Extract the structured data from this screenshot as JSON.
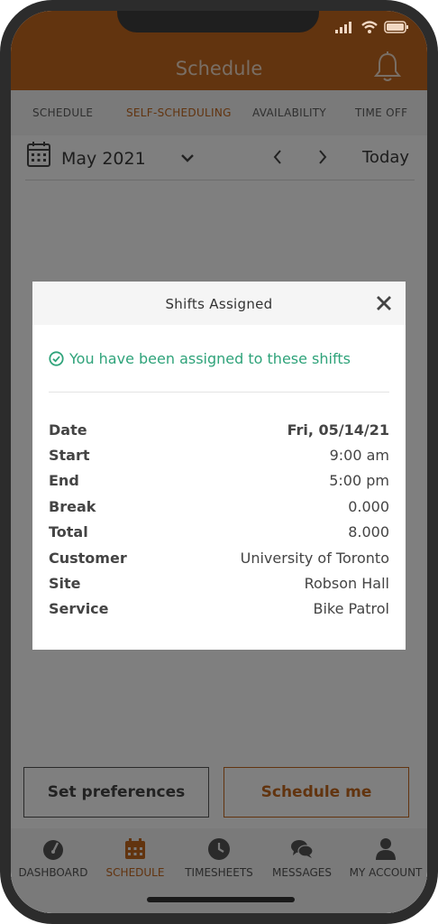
{
  "header": {
    "title": "Schedule"
  },
  "tabs": [
    {
      "label": "SCHEDULE"
    },
    {
      "label": "SELF-SCHEDULING"
    },
    {
      "label": "AVAILABILITY"
    },
    {
      "label": "TIME OFF"
    }
  ],
  "date_nav": {
    "month": "May 2021",
    "today_label": "Today"
  },
  "modal": {
    "title": "Shifts Assigned",
    "success_message": "You have been assigned to these shifts",
    "details": [
      {
        "label": "Date",
        "value": "Fri, 05/14/21"
      },
      {
        "label": "Start",
        "value": "9:00 am"
      },
      {
        "label": "End",
        "value": "5:00 pm"
      },
      {
        "label": "Break",
        "value": "0.000"
      },
      {
        "label": "Total",
        "value": "8.000"
      },
      {
        "label": "Customer",
        "value": "University of Toronto"
      },
      {
        "label": "Site",
        "value": "Robson Hall"
      },
      {
        "label": "Service",
        "value": "Bike Patrol"
      }
    ]
  },
  "actions": {
    "set_preferences": "Set preferences",
    "schedule_me": "Schedule me"
  },
  "bottom_nav": [
    {
      "label": "DASHBOARD",
      "icon": "dashboard-gauge-icon"
    },
    {
      "label": "SCHEDULE",
      "icon": "calendar-icon"
    },
    {
      "label": "TIMESHEETS",
      "icon": "clock-icon"
    },
    {
      "label": "MESSAGES",
      "icon": "chat-bubbles-icon"
    },
    {
      "label": "MY ACCOUNT",
      "icon": "user-icon"
    }
  ],
  "colors": {
    "accent": "#c5681e",
    "success": "#2fa37a",
    "overlay": "rgba(0,0,0,0.5)"
  }
}
